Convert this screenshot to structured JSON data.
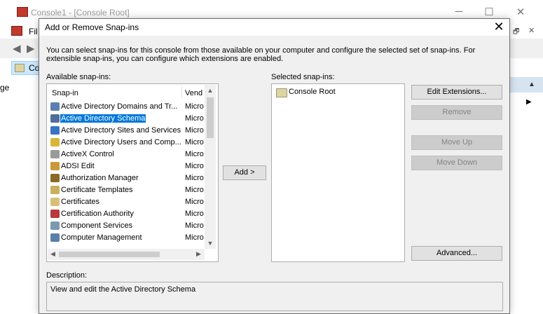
{
  "background_window": {
    "title": "Console1 - [Console Root]",
    "menu_partial": "Fil",
    "tree_item_partial": "Co",
    "edge_text": "ge"
  },
  "dialog": {
    "title": "Add or Remove Snap-ins",
    "close_glyph": "✕",
    "intro_text": "You can select snap-ins for this console from those available on your computer and configure the selected set of snap-ins. For extensible snap-ins, you can configure which extensions are enabled.",
    "available_label": "Available snap-ins:",
    "available_columns": [
      "Snap-in",
      "Vend"
    ],
    "available_items": [
      {
        "name": "Active Directory Domains and Tr...",
        "vendor": "Micro",
        "icon": "ad-domains-icon",
        "color": "#5a7fb0",
        "selected": false
      },
      {
        "name": "Active Directory Schema",
        "vendor": "Micro",
        "icon": "ad-schema-icon",
        "color": "#4f6f9a",
        "selected": true
      },
      {
        "name": "Active Directory Sites and Services",
        "vendor": "Micro",
        "icon": "ad-sites-icon",
        "color": "#3b73c4",
        "selected": false
      },
      {
        "name": "Active Directory Users and Comp...",
        "vendor": "Micro",
        "icon": "ad-users-icon",
        "color": "#d9b53a",
        "selected": false
      },
      {
        "name": "ActiveX Control",
        "vendor": "Micro",
        "icon": "activex-icon",
        "color": "#9a9a9a",
        "selected": false
      },
      {
        "name": "ADSI Edit",
        "vendor": "Micro",
        "icon": "adsi-edit-icon",
        "color": "#c99a3a",
        "selected": false
      },
      {
        "name": "Authorization Manager",
        "vendor": "Micro",
        "icon": "authorization-icon",
        "color": "#8a6a2a",
        "selected": false
      },
      {
        "name": "Certificate Templates",
        "vendor": "Micro",
        "icon": "cert-templates-icon",
        "color": "#c9b060",
        "selected": false
      },
      {
        "name": "Certificates",
        "vendor": "Micro",
        "icon": "certificates-icon",
        "color": "#d8c07a",
        "selected": false
      },
      {
        "name": "Certification Authority",
        "vendor": "Micro",
        "icon": "cert-authority-icon",
        "color": "#b83a3a",
        "selected": false
      },
      {
        "name": "Component Services",
        "vendor": "Micro",
        "icon": "component-services-icon",
        "color": "#7a9ab0",
        "selected": false
      },
      {
        "name": "Computer Management",
        "vendor": "Micro",
        "icon": "computer-management-icon",
        "color": "#5a7fa8",
        "selected": false
      }
    ],
    "add_button": "Add >",
    "selected_label": "Selected snap-ins:",
    "selected_items": [
      {
        "name": "Console Root",
        "icon": "folder-icon"
      }
    ],
    "buttons": {
      "edit_extensions": "Edit Extensions...",
      "remove": "Remove",
      "move_up": "Move Up",
      "move_down": "Move Down",
      "advanced": "Advanced..."
    },
    "description_label": "Description:",
    "description_text": "View and edit the Active Directory Schema"
  }
}
